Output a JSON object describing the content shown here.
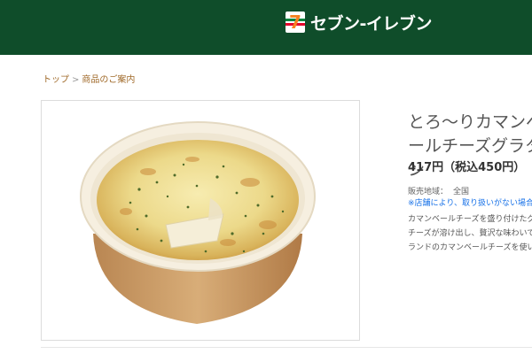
{
  "header": {
    "brand": "セブン-イレブン",
    "colors": {
      "bar": "#0f4d2a",
      "orange": "#f58220",
      "green": "#00843d",
      "red": "#e4002b"
    }
  },
  "breadcrumb": {
    "home": "トップ",
    "separator": ">",
    "current": "商品のご案内"
  },
  "product": {
    "title": "とろ〜りカマンベールチーズグラタン",
    "price": "417円（税込450円）",
    "region_label": "販売地域：",
    "region_value": "全国",
    "note": "※店舗により、取り扱いがない場合",
    "description_lines": [
      "カマンベールチーズを盛り付けたグ",
      "チーズが溶け出し、贅沢な味わいで",
      "ランドのカマンベールチーズを使い"
    ],
    "image_icon": "gratin-photo"
  }
}
